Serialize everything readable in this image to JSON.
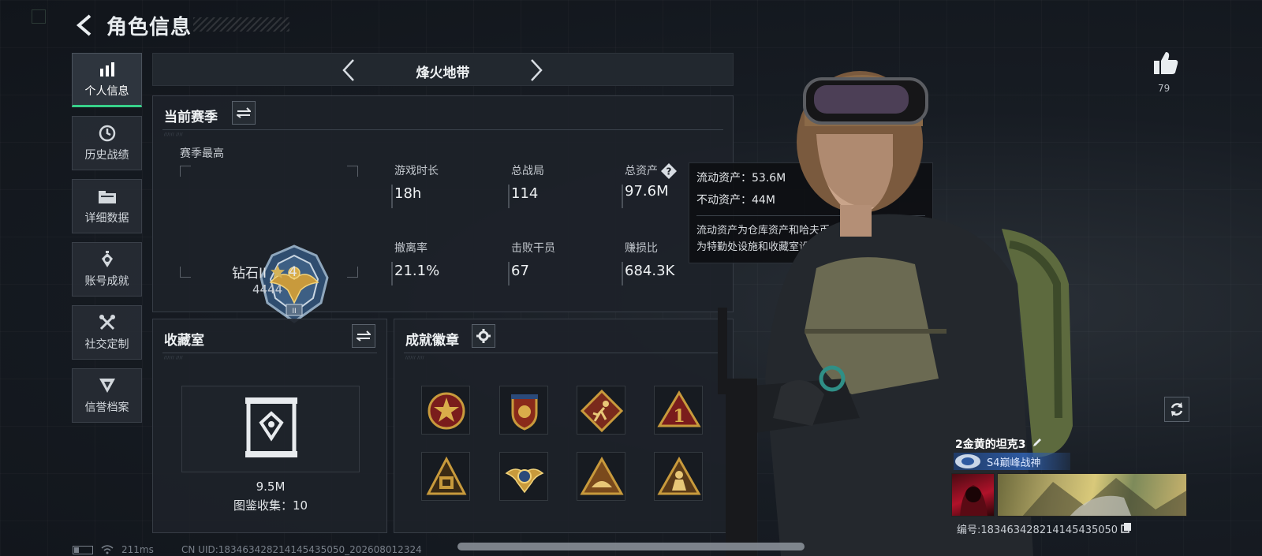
{
  "header": {
    "title": "角色信息"
  },
  "side_nav": {
    "items": [
      {
        "label": "个人信息",
        "icon": "bar-chart-icon",
        "active": true
      },
      {
        "label": "历史战绩",
        "icon": "history-clock-icon",
        "active": false
      },
      {
        "label": "详细数据",
        "icon": "folder-icon",
        "active": false
      },
      {
        "label": "账号成就",
        "icon": "achievement-icon",
        "active": false
      },
      {
        "label": "社交定制",
        "icon": "tools-icon",
        "active": false
      },
      {
        "label": "信誉档案",
        "icon": "reputation-icon",
        "active": false
      }
    ]
  },
  "mode": {
    "title": "烽火地带"
  },
  "season": {
    "title": "当前赛季",
    "best_label": "赛季最高",
    "rank_name": "钻石II",
    "rank_stars": "4",
    "rank_score": "4444",
    "stats": [
      {
        "label": "游戏时长",
        "value": "18h"
      },
      {
        "label": "总战局",
        "value": "114"
      },
      {
        "label": "总资产",
        "value": "97.6M"
      },
      {
        "label": "撤离率",
        "value": "21.1%"
      },
      {
        "label": "击败干员",
        "value": "67"
      },
      {
        "label": "赚损比",
        "value": "684.3K"
      }
    ]
  },
  "tooltip": {
    "liquid": "流动资产：53.6M",
    "fixed": "不动资产：44M",
    "desc_1": "流动资产为仓库资产和哈夫币，不动资产",
    "desc_2": "为特勤处设施和收藏室设施"
  },
  "collection": {
    "title": "收藏室",
    "value": "9.5M",
    "count_text": "图鉴收集：10"
  },
  "achievements": {
    "title": "成就徽章",
    "medals": [
      "star-medal-icon",
      "shield-medal-icon",
      "runner-medal-icon",
      "number-one-medal-icon",
      "pyramid-medal-icon",
      "wings-medal-icon",
      "triangle-medal-icon",
      "soldier-medal-icon"
    ]
  },
  "likes": {
    "count": "79"
  },
  "player": {
    "name": "2金黄的坦克3",
    "title": "S4巅峰战神",
    "id_text": "编号:183463428214145435050"
  },
  "status_bar": {
    "ping": "211ms",
    "uid": "CN UID:183463428214145435050_202608012324"
  },
  "colors": {
    "accent": "#37d18a",
    "panel": "#1d2229",
    "medal_gold": "#c89a3c",
    "medal_red": "#8a1f1f",
    "rank_blue": "#2f4d6f"
  }
}
